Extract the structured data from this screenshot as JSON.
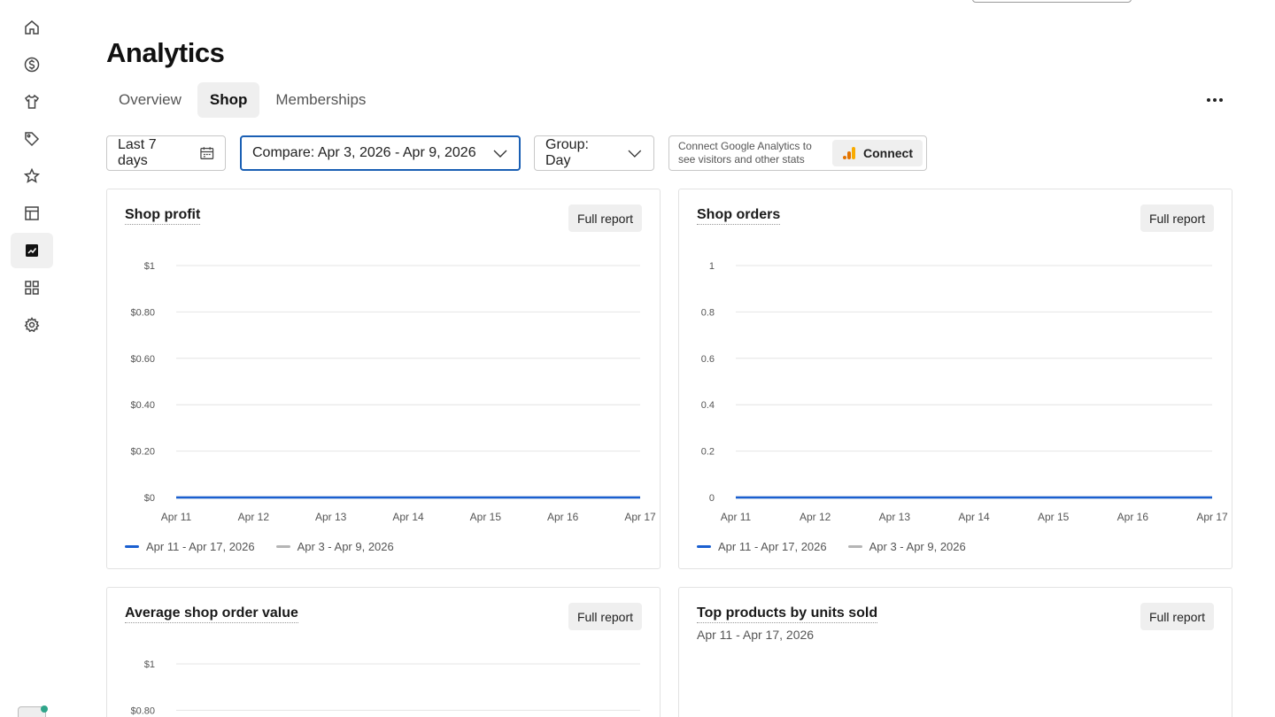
{
  "page": {
    "title": "Analytics"
  },
  "tabs": [
    {
      "label": "Overview",
      "active": false
    },
    {
      "label": "Shop",
      "active": true
    },
    {
      "label": "Memberships",
      "active": false
    }
  ],
  "sidebar": {
    "items": [
      {
        "icon": "home-icon"
      },
      {
        "icon": "dollar-icon"
      },
      {
        "icon": "shirt-icon"
      },
      {
        "icon": "tag-icon"
      },
      {
        "icon": "star-icon"
      },
      {
        "icon": "table-icon"
      },
      {
        "icon": "analytics-icon",
        "active": true
      },
      {
        "icon": "grid-icon"
      },
      {
        "icon": "gear-icon"
      }
    ]
  },
  "filters": {
    "date_range": "Last 7 days",
    "compare": "Compare: Apr 3, 2026 - Apr 9, 2026",
    "group": "Group: Day"
  },
  "google_analytics": {
    "text": "Connect Google Analytics to see visitors and other stats",
    "button": "Connect"
  },
  "cards": {
    "full_report_label": "Full report",
    "shop_profit": {
      "title": "Shop profit"
    },
    "shop_orders": {
      "title": "Shop orders"
    },
    "avg_order": {
      "title": "Average shop order value"
    },
    "top_products": {
      "title": "Top products by units sold",
      "subtitle": "Apr 11 - Apr 17, 2026"
    }
  },
  "colors": {
    "primary": "#1a5fd0",
    "compare": "#b5b5b5",
    "focus": "#1a5fb4"
  },
  "chart_data": [
    {
      "type": "line",
      "title": "Shop profit",
      "x": [
        "Apr 11",
        "Apr 12",
        "Apr 13",
        "Apr 14",
        "Apr 15",
        "Apr 16",
        "Apr 17"
      ],
      "y_ticks": [
        "$0",
        "$0.20",
        "$0.40",
        "$0.60",
        "$0.80",
        "$1"
      ],
      "ylim": [
        0,
        1
      ],
      "series": [
        {
          "name": "Apr 11 - Apr 17, 2026",
          "values": [
            0,
            0,
            0,
            0,
            0,
            0,
            0
          ],
          "color": "#1a5fd0"
        },
        {
          "name": "Apr 3 - Apr 9, 2026",
          "values": [
            0,
            0,
            0,
            0,
            0,
            0,
            0
          ],
          "color": "#b5b5b5"
        }
      ],
      "grid": true,
      "legend": "bottom-left"
    },
    {
      "type": "line",
      "title": "Shop orders",
      "x": [
        "Apr 11",
        "Apr 12",
        "Apr 13",
        "Apr 14",
        "Apr 15",
        "Apr 16",
        "Apr 17"
      ],
      "y_ticks": [
        "0",
        "0.2",
        "0.4",
        "0.6",
        "0.8",
        "1"
      ],
      "ylim": [
        0,
        1
      ],
      "series": [
        {
          "name": "Apr 11 - Apr 17, 2026",
          "values": [
            0,
            0,
            0,
            0,
            0,
            0,
            0
          ],
          "color": "#1a5fd0"
        },
        {
          "name": "Apr 3 - Apr 9, 2026",
          "values": [
            0,
            0,
            0,
            0,
            0,
            0,
            0
          ],
          "color": "#b5b5b5"
        }
      ],
      "grid": true,
      "legend": "bottom-left"
    },
    {
      "type": "line",
      "title": "Average shop order value",
      "y_ticks": [
        "$0.80",
        "$1"
      ],
      "ylim": [
        0,
        1
      ],
      "grid": true
    }
  ]
}
